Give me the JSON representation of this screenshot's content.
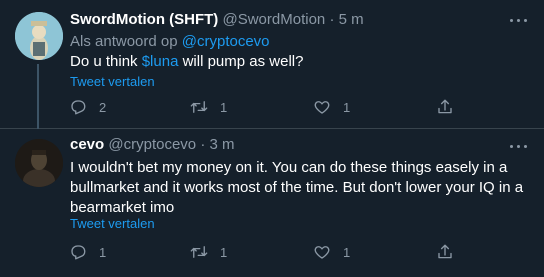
{
  "colors": {
    "background": "#15202b",
    "accent": "#1d9bf0",
    "muted": "#8b98a5",
    "text": "#ffffff"
  },
  "tweets": [
    {
      "name": "SwordMotion (SHFT)",
      "handle": "@SwordMotion",
      "separator": "·",
      "time": "5 m",
      "reply_prefix": "Als antwoord op",
      "reply_handle": "@cryptocevo",
      "text_before": "Do u think ",
      "cashtag": "$luna",
      "text_after": " will pump as well?",
      "translate": "Tweet vertalen",
      "reply_count": "2",
      "retweet_count": "1",
      "like_count": "1",
      "icons": [
        "reply-icon",
        "retweet-icon",
        "like-icon",
        "share-icon",
        "more-icon"
      ]
    },
    {
      "name": "cevo",
      "handle": "@cryptocevo",
      "separator": "·",
      "time": "3 m",
      "text": "I wouldn't bet my money on it. You can do these things easely in a bullmarket and it works most of the time. But don't lower your IQ in a bearmarket imo",
      "translate": "Tweet vertalen",
      "reply_count": "1",
      "retweet_count": "1",
      "like_count": "1",
      "icons": [
        "reply-icon",
        "retweet-icon",
        "like-icon",
        "share-icon",
        "more-icon"
      ]
    }
  ]
}
